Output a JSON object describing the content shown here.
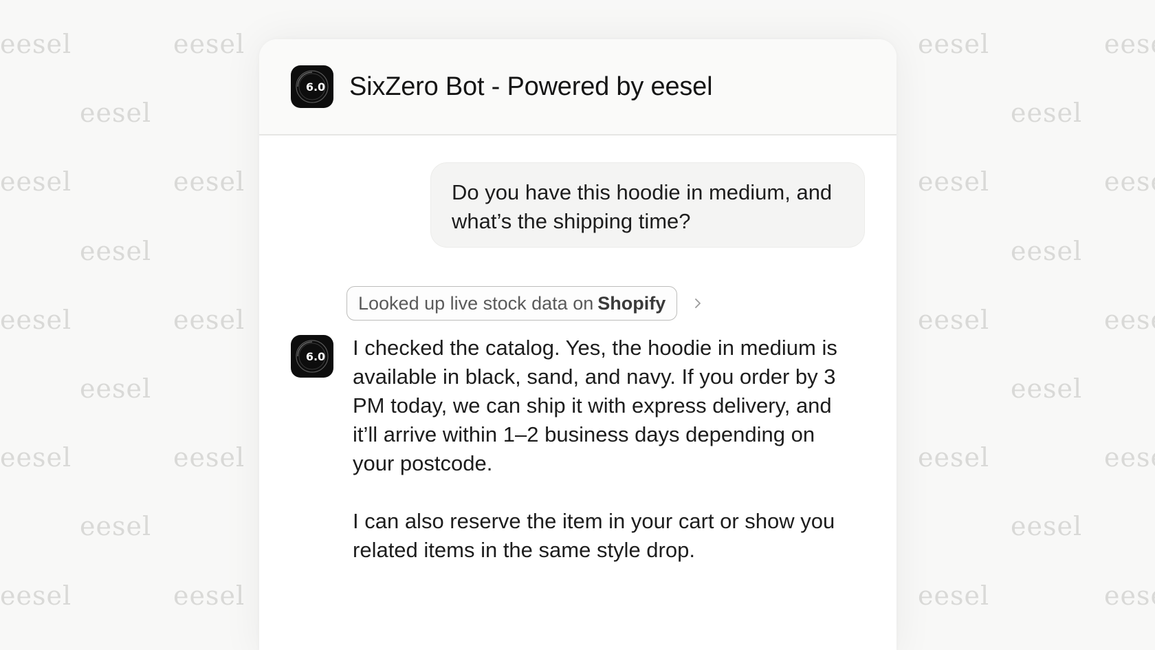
{
  "watermark": {
    "text": "eesel"
  },
  "header": {
    "avatar_text": "6.0",
    "title": "SixZero Bot - Powered by eesel"
  },
  "conversation": {
    "user_message": "Do you have this hoodie in medium, and what’s the shipping time?",
    "tool_call": {
      "prefix": "Looked up live stock data on",
      "source": "Shopify",
      "icon": "chevron-right-icon"
    },
    "bot_avatar_text": "6.0",
    "bot_message": {
      "paragraph_1": "I checked the catalog. Yes, the hoodie in medium is available in black, sand, and navy. If you order by 3 PM today, we can ship it with express delivery, and it’ll arrive within 1–2 business days depending on your postcode.",
      "paragraph_2": "I can also reserve the item in your cart or show you related items in the same style drop."
    }
  },
  "colors": {
    "background": "#f8f8f7",
    "panel": "#ffffff",
    "header": "#fafaf9",
    "user_bubble": "#f4f4f3",
    "avatar": "#0d0d0d",
    "watermark": "#d9d9d7"
  }
}
